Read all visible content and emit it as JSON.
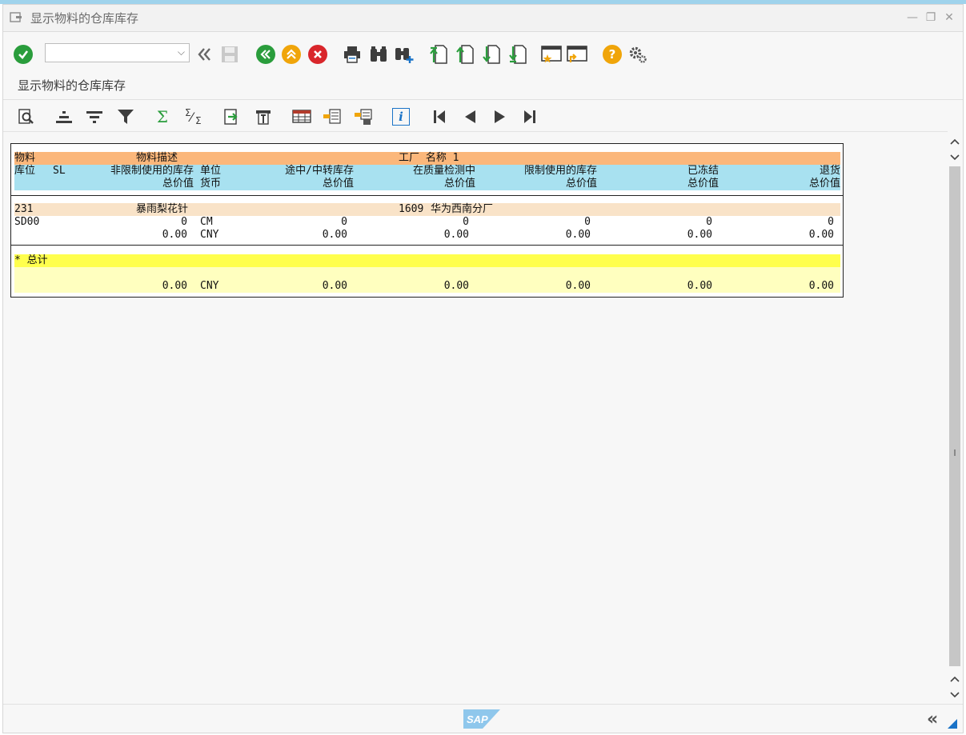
{
  "window": {
    "title": "显示物料的仓库库存",
    "controls": {
      "minimize": "—",
      "maximize": "❐",
      "close": "✕"
    }
  },
  "toolbar": {
    "command_field_value": "",
    "buttons": [
      "enter-icon",
      "back-double-icon",
      "save-icon",
      "back-icon",
      "exit-icon",
      "cancel-icon",
      "print-icon",
      "find-icon",
      "find-next-icon",
      "first-page-icon",
      "previous-page-icon",
      "next-page-icon",
      "last-page-icon",
      "create-session-icon",
      "generate-shortcut-icon",
      "help-icon",
      "settings-icon"
    ]
  },
  "page": {
    "subtitle": "显示物料的仓库库存"
  },
  "alv_toolbar": {
    "sum_symbol": "Σ",
    "subtotal_symbol": "⁄",
    "subtotal_small": "Σ",
    "info_symbol": "i"
  },
  "report": {
    "header": {
      "h1": {
        "col1": "物料",
        "col2": "物料描述",
        "col3": "工厂 名称 1"
      },
      "h2": {
        "col1": "库位",
        "col2": "SL",
        "col3": "非限制使用的库存",
        "col4": "单位",
        "col5": "途中/中转库存",
        "col6": "在质量检测中",
        "col7": "限制使用的库存",
        "col8": "已冻结",
        "col9": "退货"
      },
      "h3": {
        "col1": "总价值",
        "col2": "货币",
        "col3": "总价值",
        "col4": "总价值",
        "col5": "总价值",
        "col6": "总价值",
        "col7": "总价值"
      }
    },
    "material": {
      "number": "231",
      "description": "暴雨梨花针",
      "plant": "1609",
      "plant_name": "华为西南分厂"
    },
    "storage_row": {
      "location": "SD00",
      "unrestricted": "0",
      "unit": "CM",
      "in_transit": "0",
      "quality": "0",
      "restricted": "0",
      "blocked": "0",
      "returns": "0"
    },
    "value_row": {
      "unrestricted_value": "0.00",
      "currency": "CNY",
      "in_transit_value": "0.00",
      "quality_value": "0.00",
      "restricted_value": "0.00",
      "blocked_value": "0.00",
      "returns_value": "0.00"
    },
    "total": {
      "label": "* 总计",
      "unrestricted_value": "0.00",
      "currency": "CNY",
      "in_transit_value": "0.00",
      "quality_value": "0.00",
      "restricted_value": "0.00",
      "blocked_value": "0.00",
      "returns_value": "0.00"
    }
  },
  "statusbar": {
    "logo": "SAP",
    "collapse": "«"
  },
  "colors": {
    "header_orange": "#fbb77b",
    "header_cyan": "#a8e1f0",
    "material_row": "#f9e3c8",
    "total_yellow": "#ffff4d",
    "total_light": "#ffffbf",
    "accent_blue": "#1a73c7"
  }
}
